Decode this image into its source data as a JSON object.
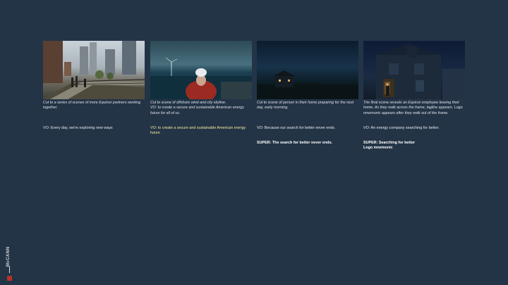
{
  "frames": [
    {
      "desc": "Cut to a series of scenes of more Equinor partners working together.",
      "vo": "VO: Every day, we're exploring new ways",
      "super": ""
    },
    {
      "desc": "Cut to scene of offshore wind and city skyline.\nVO: to create a secure and sustainable American energy future for all of us.",
      "vo": "VO: to create a secure and sustainable American energy future",
      "super": ""
    },
    {
      "desc": "Cut to scene of person in their home preparing for the next day, early morning.",
      "vo": "VO: Because our search for better never ends.",
      "super": "SUPER:  The search for better never ends."
    },
    {
      "desc": "The final scene reveals an Equinor employee leaving their home. As they walk across the frame, tagline appears. Logo mnemonic appears after they walk out of the frame.",
      "vo": "VO: An energy company searching for better.",
      "super": "SUPER: Searching for better\nLogo mnemonic"
    }
  ],
  "brand": {
    "logo_text": "McCANN",
    "accent": "#b7322a"
  },
  "colors": {
    "background": "#243447",
    "vo_highlight": "#f2ec9a"
  }
}
